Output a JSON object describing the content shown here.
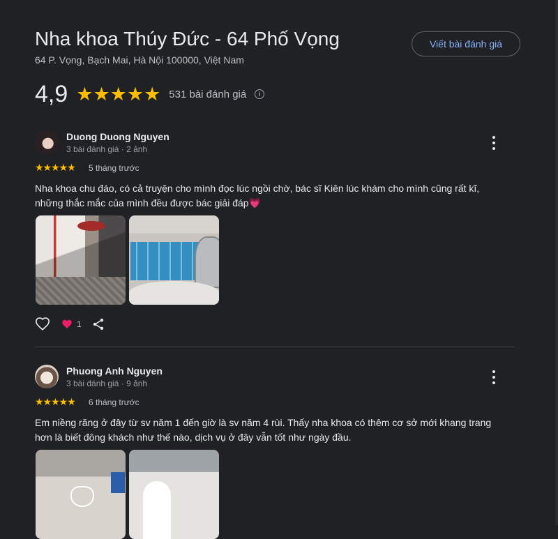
{
  "place": {
    "title": "Nha khoa Thúy Đức - 64 Phố Vọng",
    "address": "64 P. Vọng, Bạch Mai, Hà Nội 100000, Việt Nam",
    "write_review_label": "Viết bài đánh giá",
    "rating": "4,9",
    "rating_stars": "★★★★★",
    "rating_value": 4.9,
    "review_count": "531 bài đánh giá"
  },
  "reviews": [
    {
      "name": "Duong Duong Nguyen",
      "meta": "3 bài đánh giá · 2 ảnh",
      "stars": "★★★★★",
      "star_value": 5,
      "time": "5 tháng trước",
      "text": "Nha khoa chu đáo, có cả truyện cho mình đọc lúc ngồi chờ, bác sĩ Kiên lúc khám cho mình cũng rất kĩ, những thắc mắc của mình đều được bác giải đáp",
      "emoji": "💗",
      "reaction_count": "1"
    },
    {
      "name": "Phuong Anh Nguyen",
      "meta": "3 bài đánh giá · 9 ảnh",
      "stars": "★★★★★",
      "star_value": 5,
      "time": "6 tháng trước",
      "text": "Em niềng răng ở đây từ sv năm 1 đến giờ là sv năm 4 rùi. Thấy nha khoa có thêm cơ sở mới khang trang hơn là biết đông khách như thế nào, dịch vụ ở đây vẫn tốt như ngày đầu."
    }
  ],
  "colors": {
    "background": "#202124",
    "star": "#fbbc04",
    "link": "#8ab4f8",
    "heart": "#e91e63"
  }
}
